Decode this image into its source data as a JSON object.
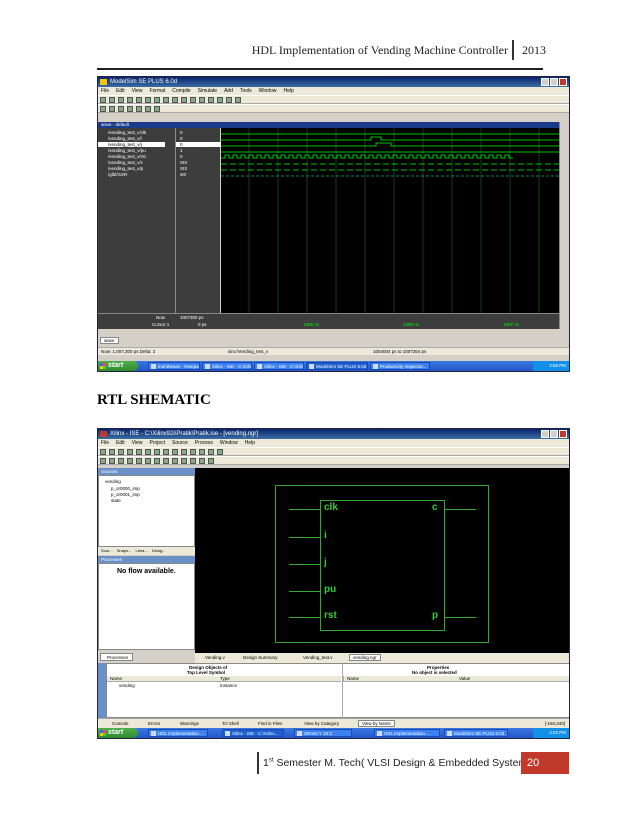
{
  "header": {
    "title": "HDL Implementation of Vending Machine Controller",
    "year": "2013"
  },
  "section_title": "RTL SHEMATIC",
  "footer": {
    "ordinal": "1",
    "ordinal_suffix": "st",
    "text": "Semester M. Tech( VLSI Design & Embedded Systems)",
    "page": "20"
  },
  "modelsim": {
    "title": "ModelSim SE PLUS 6.0d",
    "menu": [
      "File",
      "Edit",
      "View",
      "Format",
      "Compile",
      "Simulate",
      "Add",
      "Tools",
      "Window",
      "Help"
    ],
    "wave_title": "wave - default",
    "signals": [
      "/vending_test_v/clk",
      "/vending_test_v/i",
      "/vending_test_v/j",
      "/vending_test_v/pu",
      "/vending_test_v/rst",
      "/vending_test_v/c",
      "/vending_test_v/p",
      "/glbl/GSR"
    ],
    "values": [
      "0",
      "0",
      "0",
      "1",
      "0",
      "StX",
      "StX",
      "st0"
    ],
    "now_label": "Now",
    "now_value": "1007300 ps",
    "cursor_label": "Cursor 1",
    "cursor_value": "0 ps",
    "time_marks": [
      "1005 ns",
      "1006 ns",
      "1007 ns"
    ],
    "tab": "wave",
    "status_now": "Now: 1,007,300 ps  Delta: 2",
    "status_path": "sim:/Vending_test_v",
    "status_range": "1004004 ps to 1007364 ps",
    "taskbar": {
      "start": "start",
      "buttons": [
        "muhthesan - Notepad",
        "Xilinx - ISE - C:\\Xilinx...",
        "Xilinx - ISE - C:\\Xilin...",
        "ModelSim SE PLUS 6.0d",
        "Productivity Inspector..."
      ],
      "clock": "2:55 PM"
    }
  },
  "ise": {
    "title": "Xilinx - ISE - C:\\Xilinx92i\\Pratik\\Pratik.ise - [vending.ngr]",
    "menu": [
      "File",
      "Edit",
      "View",
      "Project",
      "Source",
      "Process",
      "Window",
      "Help"
    ],
    "sources_label": "Sources",
    "tree": [
      "vending",
      "p_or0000_imp",
      "p_or0001_imp",
      "state"
    ],
    "panel_tabs": [
      "Sour...",
      "Snaps...",
      "Libra...",
      "Desig..."
    ],
    "processes_label": "Processes",
    "no_flow": "No flow available.",
    "processes_tab": "Processes",
    "doc_tabs": [
      "Vending.v",
      "Design Summary",
      "Vending_test.v",
      "vending.ngr"
    ],
    "symbol": {
      "left_pins": [
        "clk",
        "i",
        "j",
        "pu",
        "rst"
      ],
      "right_pins": [
        "c",
        "p"
      ]
    },
    "design_objects_title": "Design Objects of",
    "design_objects_subtitle": "Top Level Symbol",
    "properties_title": "Properties",
    "properties_subtitle": "No object is selected",
    "col_name": "Name",
    "col_type": "Type",
    "col_value": "Value",
    "row_name": "vending",
    "row_type": "Instance",
    "bottom_tabs": [
      "Console",
      "Errors",
      "Warnings",
      "Tcl Shell",
      "Find in Files",
      "View by Category",
      "View by Name"
    ],
    "coords": "[-160,340]",
    "taskbar": {
      "start": "start",
      "buttons": [
        "HDL Implementation ...",
        "Xilinx - ISE - C:\\Xilinx...",
        "SRAIN Y 15:2",
        "HDL Implementation ...",
        "ModelSim SE PLUS 6.0d"
      ],
      "clock": "3:22 PM"
    }
  }
}
